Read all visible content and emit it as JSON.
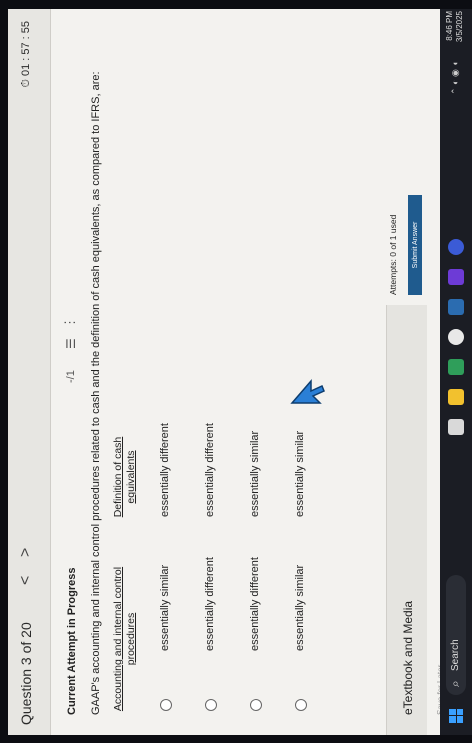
{
  "header": {
    "question_title": "Question 3 of 20",
    "prev_glyph": "<",
    "next_glyph": ">",
    "timer": "01 : 57 : 55",
    "timer_icon": "clock-icon"
  },
  "attempt": {
    "status": "Current Attempt in Progress",
    "score": "-/1",
    "list_icon": "list-icon",
    "more_icon": "more-icon"
  },
  "question": {
    "text": "GAAP's accounting and internal control procedures related to cash and the definition of cash equivalents, as compared to IFRS, are:",
    "columns": [
      "Accounting and internal control procedures",
      "Definition of cash equivalents"
    ],
    "options": [
      {
        "col1": "essentially similar",
        "col2": "essentially different"
      },
      {
        "col1": "essentially different",
        "col2": "essentially different"
      },
      {
        "col1": "essentially different",
        "col2": "essentially similar"
      },
      {
        "col1": "essentially similar",
        "col2": "essentially similar"
      }
    ]
  },
  "footer": {
    "etextbook": "eTextbook and Media",
    "support": "Save for Later",
    "attempts": "Attempts: 0 of 1 used",
    "submit": "Submit Answer"
  },
  "taskbar": {
    "search": "Search",
    "time": "8:46 PM",
    "date": "3/5/2025"
  },
  "colors": {
    "accent": "#1f5b8e",
    "cursor": "#2a7fd6"
  }
}
